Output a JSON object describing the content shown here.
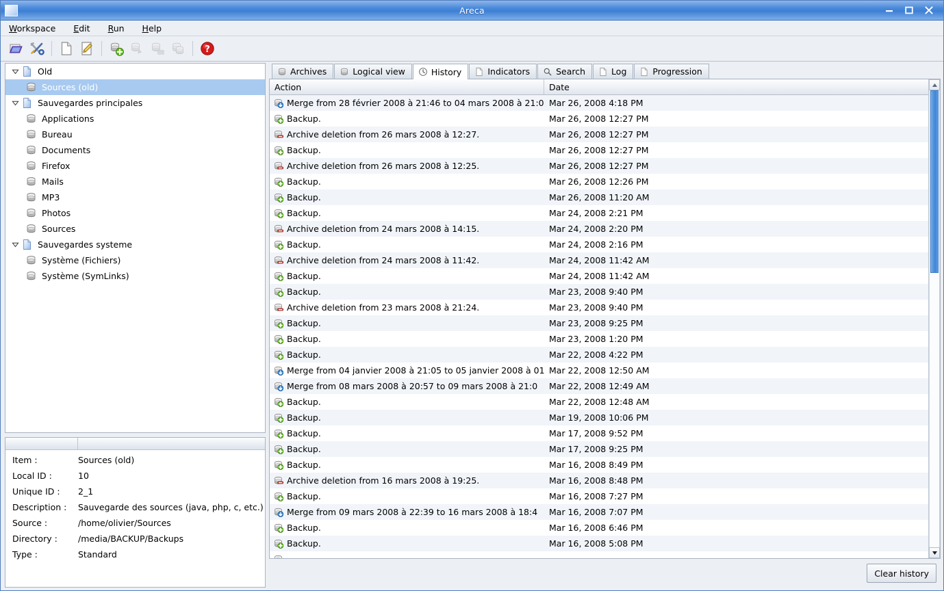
{
  "window": {
    "title": "Areca",
    "controls": {
      "minimize": "minimize-icon",
      "maximize": "maximize-icon",
      "close": "close-icon"
    }
  },
  "menubar": {
    "items": [
      {
        "label": "Workspace",
        "mnemonic": "W"
      },
      {
        "label": "Edit",
        "mnemonic": "E"
      },
      {
        "label": "Run",
        "mnemonic": "R"
      },
      {
        "label": "Help",
        "mnemonic": "H"
      }
    ]
  },
  "toolbar": {
    "buttons": [
      {
        "name": "open-workspace-icon",
        "enabled": true
      },
      {
        "name": "preferences-tools-icon",
        "enabled": true
      },
      {
        "name": "new-group-icon",
        "enabled": true
      },
      {
        "name": "edit-group-icon",
        "enabled": true
      },
      {
        "name": "new-target-icon",
        "enabled": true
      },
      {
        "name": "edit-target-icon",
        "enabled": false
      },
      {
        "name": "duplicate-target-icon",
        "enabled": false
      },
      {
        "name": "delete-target-icon",
        "enabled": false
      },
      {
        "name": "help-icon",
        "enabled": true
      }
    ]
  },
  "tree": {
    "nodes": [
      {
        "label": "Old",
        "type": "group",
        "expanded": true,
        "level": 1,
        "selected": false
      },
      {
        "label": "Sources (old)",
        "type": "target",
        "expanded": false,
        "level": 2,
        "selected": true
      },
      {
        "label": "Sauvegardes principales",
        "type": "group",
        "expanded": true,
        "level": 1,
        "selected": false
      },
      {
        "label": "Applications",
        "type": "target",
        "expanded": false,
        "level": 2,
        "selected": false
      },
      {
        "label": "Bureau",
        "type": "target",
        "expanded": false,
        "level": 2,
        "selected": false
      },
      {
        "label": "Documents",
        "type": "target",
        "expanded": false,
        "level": 2,
        "selected": false
      },
      {
        "label": "Firefox",
        "type": "target",
        "expanded": false,
        "level": 2,
        "selected": false
      },
      {
        "label": "Mails",
        "type": "target",
        "expanded": false,
        "level": 2,
        "selected": false
      },
      {
        "label": "MP3",
        "type": "target",
        "expanded": false,
        "level": 2,
        "selected": false
      },
      {
        "label": "Photos",
        "type": "target",
        "expanded": false,
        "level": 2,
        "selected": false
      },
      {
        "label": "Sources",
        "type": "target",
        "expanded": false,
        "level": 2,
        "selected": false
      },
      {
        "label": "Sauvegardes systeme",
        "type": "group",
        "expanded": true,
        "level": 1,
        "selected": false
      },
      {
        "label": "Système (Fichiers)",
        "type": "target",
        "expanded": false,
        "level": 2,
        "selected": false
      },
      {
        "label": "Système (SymLinks)",
        "type": "target",
        "expanded": false,
        "level": 2,
        "selected": false
      }
    ]
  },
  "details": {
    "rows": [
      {
        "key": "Item :",
        "value": "Sources (old)"
      },
      {
        "key": "Local ID :",
        "value": "10"
      },
      {
        "key": "Unique ID :",
        "value": "2_1"
      },
      {
        "key": "Description :",
        "value": "Sauvegarde des sources (java, php, c, etc.)"
      },
      {
        "key": "Source :",
        "value": "/home/olivier/Sources"
      },
      {
        "key": "Directory :",
        "value": "/media/BACKUP/Backups"
      },
      {
        "key": "Type :",
        "value": "Standard"
      }
    ]
  },
  "tabs": [
    {
      "label": "Archives",
      "icon": "database-icon",
      "active": false
    },
    {
      "label": "Logical view",
      "icon": "database-icon",
      "active": false
    },
    {
      "label": "History",
      "icon": "clock-icon",
      "active": true
    },
    {
      "label": "Indicators",
      "icon": "page-icon",
      "active": false
    },
    {
      "label": "Search",
      "icon": "search-icon",
      "active": false
    },
    {
      "label": "Log",
      "icon": "page-icon",
      "active": false
    },
    {
      "label": "Progression",
      "icon": "page-icon",
      "active": false
    }
  ],
  "history": {
    "columns": [
      "Action",
      "Date"
    ],
    "rows": [
      {
        "icon": "merge-icon",
        "action": "Merge from 28 février 2008 à 21:46 to 04 mars 2008 à 21:0",
        "date": "Mar 26, 2008 4:18 PM"
      },
      {
        "icon": "backup-icon",
        "action": "Backup.",
        "date": "Mar 26, 2008 12:27 PM"
      },
      {
        "icon": "delete-icon",
        "action": "Archive deletion from 26 mars 2008 à 12:27.",
        "date": "Mar 26, 2008 12:27 PM"
      },
      {
        "icon": "backup-icon",
        "action": "Backup.",
        "date": "Mar 26, 2008 12:27 PM"
      },
      {
        "icon": "delete-icon",
        "action": "Archive deletion from 26 mars 2008 à 12:25.",
        "date": "Mar 26, 2008 12:27 PM"
      },
      {
        "icon": "backup-icon",
        "action": "Backup.",
        "date": "Mar 26, 2008 12:26 PM"
      },
      {
        "icon": "backup-icon",
        "action": "Backup.",
        "date": "Mar 26, 2008 11:20 AM"
      },
      {
        "icon": "backup-icon",
        "action": "Backup.",
        "date": "Mar 24, 2008 2:21 PM"
      },
      {
        "icon": "delete-icon",
        "action": "Archive deletion from 24 mars 2008 à 14:15.",
        "date": "Mar 24, 2008 2:20 PM"
      },
      {
        "icon": "backup-icon",
        "action": "Backup.",
        "date": "Mar 24, 2008 2:16 PM"
      },
      {
        "icon": "delete-icon",
        "action": "Archive deletion from 24 mars 2008 à 11:42.",
        "date": "Mar 24, 2008 11:42 AM"
      },
      {
        "icon": "backup-icon",
        "action": "Backup.",
        "date": "Mar 24, 2008 11:42 AM"
      },
      {
        "icon": "backup-icon",
        "action": "Backup.",
        "date": "Mar 23, 2008 9:40 PM"
      },
      {
        "icon": "delete-icon",
        "action": "Archive deletion from 23 mars 2008 à 21:24.",
        "date": "Mar 23, 2008 9:40 PM"
      },
      {
        "icon": "backup-icon",
        "action": "Backup.",
        "date": "Mar 23, 2008 9:25 PM"
      },
      {
        "icon": "backup-icon",
        "action": "Backup.",
        "date": "Mar 23, 2008 1:20 PM"
      },
      {
        "icon": "backup-icon",
        "action": "Backup.",
        "date": "Mar 22, 2008 4:22 PM"
      },
      {
        "icon": "merge-icon",
        "action": "Merge from 04 janvier 2008 à 21:05 to 05 janvier 2008 à 01",
        "date": "Mar 22, 2008 12:50 AM"
      },
      {
        "icon": "merge-icon",
        "action": "Merge from 08 mars 2008 à 20:57 to 09 mars 2008 à 21:0",
        "date": "Mar 22, 2008 12:49 AM"
      },
      {
        "icon": "backup-icon",
        "action": "Backup.",
        "date": "Mar 22, 2008 12:48 AM"
      },
      {
        "icon": "backup-icon",
        "action": "Backup.",
        "date": "Mar 19, 2008 10:06 PM"
      },
      {
        "icon": "backup-icon",
        "action": "Backup.",
        "date": "Mar 17, 2008 9:52 PM"
      },
      {
        "icon": "backup-icon",
        "action": "Backup.",
        "date": "Mar 17, 2008 9:25 PM"
      },
      {
        "icon": "backup-icon",
        "action": "Backup.",
        "date": "Mar 16, 2008 8:49 PM"
      },
      {
        "icon": "delete-icon",
        "action": "Archive deletion from 16 mars 2008 à 19:25.",
        "date": "Mar 16, 2008 8:48 PM"
      },
      {
        "icon": "backup-icon",
        "action": "Backup.",
        "date": "Mar 16, 2008 7:27 PM"
      },
      {
        "icon": "merge-icon",
        "action": "Merge from 09 mars 2008 à 22:39 to 16 mars 2008 à 18:4",
        "date": "Mar 16, 2008 7:07 PM"
      },
      {
        "icon": "backup-icon",
        "action": "Backup.",
        "date": "Mar 16, 2008 6:46 PM"
      },
      {
        "icon": "backup-icon",
        "action": "Backup.",
        "date": "Mar 16, 2008 5:08 PM"
      },
      {
        "icon": "backup-icon",
        "action": "",
        "date": ""
      }
    ]
  },
  "scrollbar": {
    "thumb_percent": 40
  },
  "footer": {
    "clear_history_label": "Clear history"
  },
  "colors": {
    "title_blue": "#4a8adb",
    "selection_blue": "#a8caf0",
    "row_stripe": "#f1f4f9",
    "backup_green": "#57b317",
    "delete_red": "#d13b2a",
    "merge_blue": "#2f87d8",
    "help_red": "#d51a1a"
  }
}
